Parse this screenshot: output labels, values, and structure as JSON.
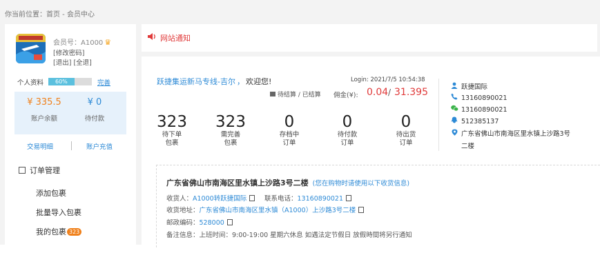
{
  "breadcrumb": {
    "prefix": "你当前位置：",
    "home": "首页",
    "sep": " - ",
    "current": "会员中心"
  },
  "account": {
    "member_no": "会员号：A1000",
    "change_password": "[修改密码]",
    "logout": "[退出]",
    "all": "[全退]",
    "profile_label": "个人资料",
    "profile_percent_text": "60%",
    "profile_progress": 0.6,
    "complete_link": "完善",
    "balance_value": "¥ 335.5",
    "balance_label": "账户余额",
    "pending_value": "¥ 0",
    "pending_label": "待付款",
    "transactions_link": "交易明细",
    "recharge_link": "账户充值"
  },
  "menu": {
    "header": "订单管理",
    "items": [
      {
        "label": "添加包裹"
      },
      {
        "label": "批量导入包裹"
      },
      {
        "label": "我的包裹",
        "badge": "323"
      }
    ]
  },
  "notice": {
    "title": "网站通知"
  },
  "welcome": {
    "company": "跃捷集运新马专线-吉尔",
    "sep": "，",
    "greeting": "欢迎您!",
    "login": "Login: 2021/7/5 10:54:38",
    "calc_label": "待结算 / 已结算",
    "commission_label": "佣金(¥):",
    "pending_commission": "0.04",
    "settled_commission": "31.395"
  },
  "stats": [
    {
      "value": "323",
      "line1": "待下单",
      "line2": "包裹"
    },
    {
      "value": "323",
      "line1": "需完善",
      "line2": "包裹"
    },
    {
      "value": "0",
      "line1": "存档中",
      "line2": "订单"
    },
    {
      "value": "0",
      "line1": "待付款",
      "line2": "订单"
    },
    {
      "value": "0",
      "line1": "待出货",
      "line2": "订单"
    }
  ],
  "contact": {
    "name": "跃捷国际",
    "phone": "13160890021",
    "wechat": "13160890021",
    "qq": "512385137",
    "address_line1": "广东省佛山市南海区里水镇上沙路3号",
    "address_line2": "二楼"
  },
  "shipping": {
    "title": "广东省佛山市南海区里水镇上沙路3号二楼",
    "hint": "(您在购物时请使用以下收货信息)",
    "recipient_label": "收货人：",
    "recipient": "A1000转跃捷国际",
    "phone_label": "联系电话：",
    "phone": "13160890021",
    "address_label": "收货地址：",
    "address": "广东省佛山市南海区里水镇（A1000）上沙路3号二楼",
    "zip_label": "邮政编码：",
    "zip": "528000",
    "note_label": "备注信息：",
    "note": "上班时间：9:00-19:00 星期六休息 如遇法定节假日 放假時間将另行通知"
  },
  "colors": {
    "accent_blue": "#2d8ad6",
    "accent_red": "#e03a3a",
    "accent_orange": "#f0811c",
    "progress": "#5bc0de"
  }
}
